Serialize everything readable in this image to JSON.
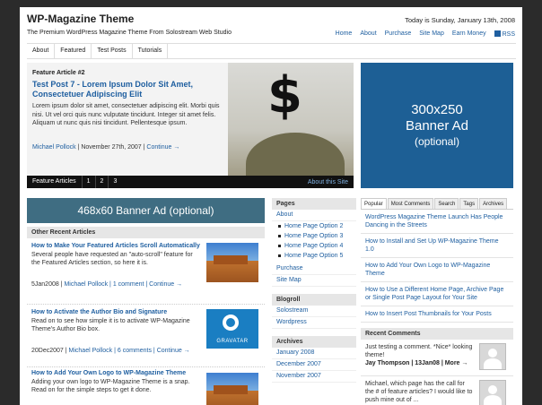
{
  "header": {
    "title": "WP-Magazine Theme",
    "tagline": "The Premium WordPress Magazine Theme From Solostream Web Studio",
    "date": "Today is Sunday, January 13th, 2008",
    "topnav": [
      "Home",
      "About",
      "Purchase",
      "Site Map",
      "Earn Money",
      "RSS"
    ]
  },
  "mainnav": [
    "About",
    "Featured",
    "Test Posts",
    "Tutorials"
  ],
  "feature": {
    "kicker": "Feature Article #2",
    "title": "Test Post 7 - Lorem Ipsum Dolor Sit Amet, Consectetuer Adipiscing Elit",
    "body": "Lorem ipsum dolor sit amet, consectetuer adipiscing elit. Morbi quis nisi. Ut vel orci quis nunc vulputate tincidunt. Integer sit amet felis. Aliquam ut nunc quis nisi tincidunt. Pellentesque ipsum.",
    "author": "Michael Pollock",
    "date": " | November 27th, 2007 | ",
    "continue": "Continue →",
    "image_text": "$",
    "bar_label": "Feature Articles",
    "pages": [
      "1",
      "2",
      "3"
    ],
    "about": "About this Site"
  },
  "banner300": {
    "line1": "300x250",
    "line2": "Banner Ad",
    "line3": "(optional)"
  },
  "banner468": "468x60 Banner Ad (optional)",
  "recent": {
    "header": "Other Recent Articles",
    "posts": [
      {
        "title": "How to Make Your Featured Articles Scroll Automatically",
        "body": "Several people have requested an \"auto-scroll\" feature for the Featured Articles section, so here it is.",
        "date": "5Jan2008 | ",
        "author": "Michael Pollock",
        "comments": " | 1 comment | ",
        "continue": "Continue →"
      },
      {
        "title": "How to Activate the Author Bio and Signature",
        "body": "Read on to see how simple it is to activate WP-Magazine Theme's Author Bio box.",
        "date": "20Dec2007 | ",
        "author": "Michael Pollock",
        "comments": " | 6 comments | ",
        "continue": "Continue →",
        "thumb_text": "GRAVATAR"
      },
      {
        "title": "How to Add Your Own Logo to WP-Magazine Theme",
        "body": "Adding your own logo to WP-Magazine Theme is a snap. Read on for the simple steps to get it done."
      }
    ]
  },
  "pages_box": {
    "header": "Pages",
    "about": "About",
    "subs": [
      "Home Page Option 2",
      "Home Page Option 3",
      "Home Page Option 4",
      "Home Page Option 5"
    ],
    "purchase": "Purchase",
    "sitemap": "Site Map"
  },
  "blogroll": {
    "header": "Blogroll",
    "items": [
      "Solostream",
      "Wordpress"
    ]
  },
  "archives": {
    "header": "Archives",
    "items": [
      "January 2008",
      "December 2007",
      "November 2007"
    ]
  },
  "tabs": [
    "Popular",
    "Most Comments",
    "Search",
    "Tags",
    "Archives"
  ],
  "popular": [
    "WordPress Magazine Theme Launch Has People Dancing in the Streets",
    "How to Install and Set Up WP-Magazine Theme 1.0",
    "How to Add Your Own Logo to WP-Magazine Theme",
    "How to Use a Different Home Page, Archive Page or Single Post Page Layout for Your Site",
    "How to Insert Post Thumbnails for Your Posts"
  ],
  "recent_comments": {
    "header": "Recent Comments",
    "items": [
      {
        "text": "Just testing a comment. *Nice* looking theme!",
        "author": "Jay Thompson | 13Jan08 | More →"
      },
      {
        "text": "Michael, which page has the call for the # of feature articles? I would like to push mine out of ..."
      }
    ]
  }
}
